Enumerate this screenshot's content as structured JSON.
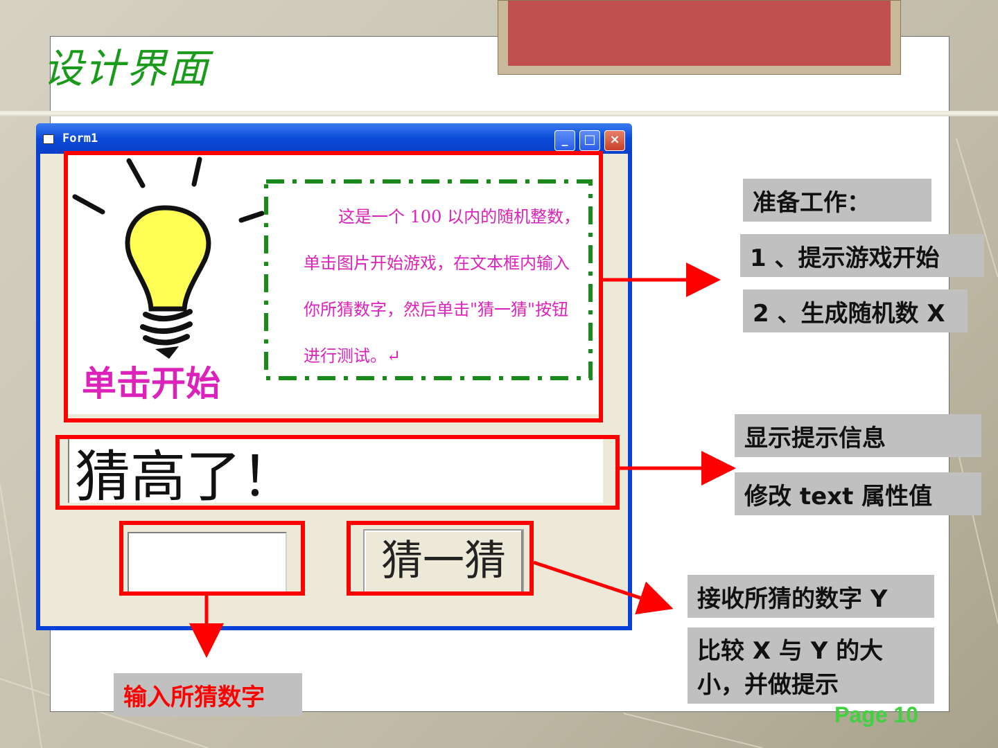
{
  "slide": {
    "title": "设计界面",
    "page_label": "Page 10"
  },
  "window": {
    "title": "Form1",
    "minimize_glyph": "_",
    "maximize_glyph": "□",
    "close_glyph": "×"
  },
  "form": {
    "intro_lines": [
      "这是一个 100 以内的随机整数，",
      "单击图片开始游戏，在文本框内输入",
      "你所猜数字，然后单击\"猜一猜\"按钮",
      "进行测试。↵"
    ],
    "start_label": "单击开始",
    "hint_text": "猜高了！",
    "guess_input_value": "",
    "guess_button_label": "猜一猜"
  },
  "callouts": {
    "prep_title": "准备工作：",
    "prep_step1": "1 、提示游戏开始",
    "prep_step2": "2 、生成随机数 X",
    "show_hint": "显示提示信息",
    "modify_text": "修改 text 属性值",
    "receive_guess": "接收所猜的数字 Y",
    "compare_line1": "比较 X 与 Y 的大",
    "compare_line2": "小，并做提示",
    "input_guess": "输入所猜数字"
  },
  "colors": {
    "title_green": "#1a9a1a",
    "accent_red": "#ff0000",
    "magenta_text": "#dd22bb",
    "callout_gray": "#c0c0c0",
    "window_blue": "#0a3fd8",
    "page_green": "#3fd13f",
    "header_block": "#c0504d"
  }
}
